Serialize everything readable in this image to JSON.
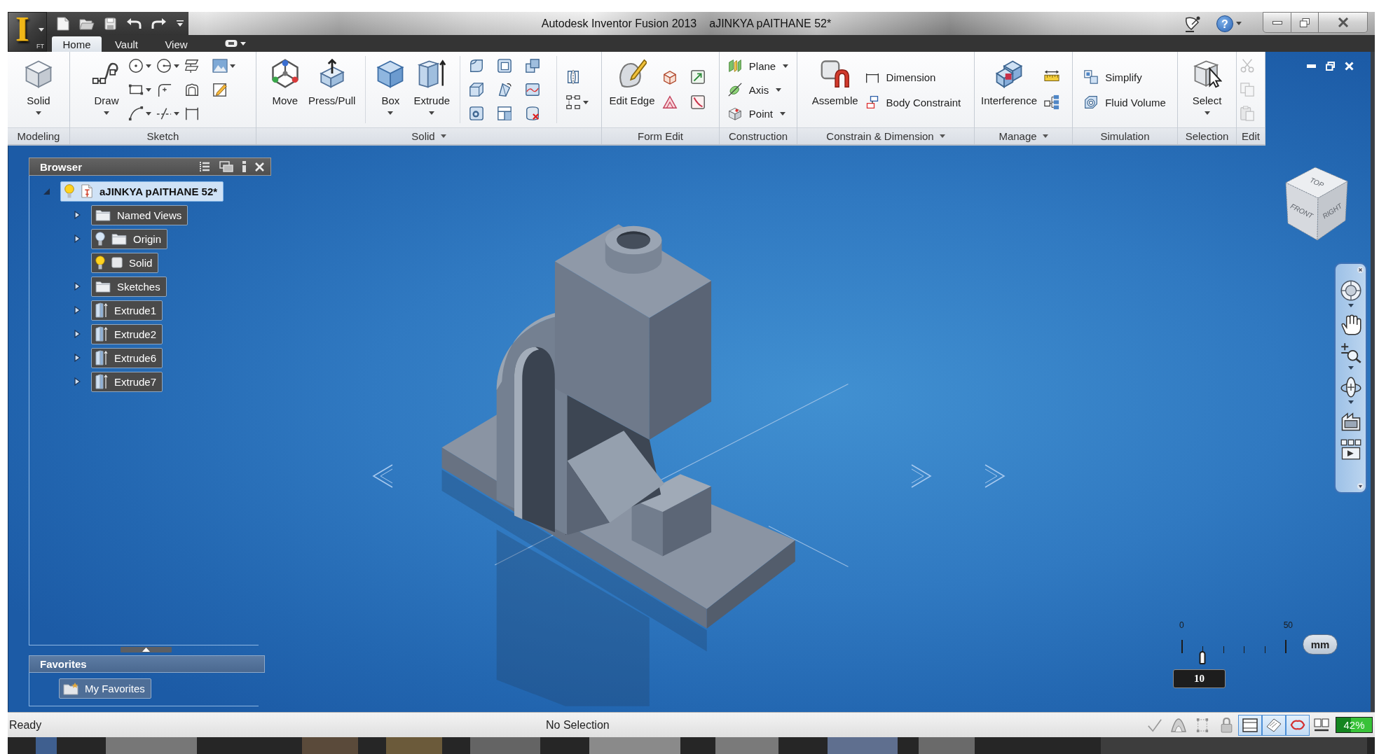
{
  "app_button": {
    "logo": "I",
    "badge": "FT"
  },
  "window": {
    "title": "Autodesk Inventor Fusion 2013",
    "document": "aJINKYA pAITHANE 52*"
  },
  "help_button": {
    "label": "?"
  },
  "tabs": [
    {
      "label": "Home",
      "selected": true
    },
    {
      "label": "Vault",
      "selected": false
    },
    {
      "label": "View",
      "selected": false
    }
  ],
  "ribbon": {
    "panels": [
      {
        "label": "Modeling",
        "expandable": false,
        "tools": [
          {
            "kind": "large",
            "label": "Solid",
            "dropdown": true
          }
        ]
      },
      {
        "label": "Sketch",
        "expandable": false,
        "tools": [
          {
            "kind": "large",
            "label": "Draw",
            "dropdown": true
          },
          {
            "kind": "icons",
            "rows": [
              [
                {
                  "dropdown": true
                },
                {
                  "dropdown": true
                },
                {
                  "dropdown": false
                },
                {
                  "dropdown": true
                }
              ],
              [
                {
                  "dropdown": true
                },
                {
                  "dropdown": false
                },
                {
                  "dropdown": false
                },
                {
                  "dropdown": false
                }
              ],
              [
                {
                  "dropdown": true
                },
                {
                  "dropdown": true
                },
                {
                  "dropdown": false
                }
              ]
            ]
          }
        ]
      },
      {
        "label": "Solid",
        "expandable": true,
        "tools": [
          {
            "kind": "large",
            "label": "Move",
            "dropdown": false
          },
          {
            "kind": "large",
            "label": "Press/Pull",
            "dropdown": false
          },
          {
            "kind": "large",
            "label": "Box",
            "dropdown": true
          },
          {
            "kind": "large",
            "label": "Extrude",
            "dropdown": true
          },
          {
            "kind": "icons",
            "rows": [
              [
                {
                  "dropdown": false
                },
                {
                  "dropdown": false
                },
                {
                  "dropdown": false
                }
              ],
              [
                {
                  "dropdown": false
                },
                {
                  "dropdown": false
                },
                {
                  "dropdown": false
                }
              ],
              [
                {
                  "dropdown": false
                },
                {
                  "dropdown": false
                },
                {
                  "dropdown": false
                }
              ]
            ]
          },
          {
            "kind": "icons",
            "rows": [
              [
                {
                  "dropdown": false
                }
              ],
              [
                {
                  "dropdown": true
                }
              ]
            ]
          }
        ]
      },
      {
        "label": "Form Edit",
        "expandable": false,
        "tools": [
          {
            "kind": "large",
            "label": "Edit Edge",
            "dropdown": false
          },
          {
            "kind": "icons",
            "rows": [
              [
                {
                  "dropdown": false
                },
                {
                  "dropdown": false
                }
              ],
              [
                {
                  "dropdown": false
                },
                {
                  "dropdown": false
                }
              ]
            ]
          }
        ]
      },
      {
        "label": "Construction",
        "expandable": false,
        "tools": [
          {
            "kind": "small",
            "label": "Plane",
            "dropdown": true
          },
          {
            "kind": "small",
            "label": "Axis",
            "dropdown": true
          },
          {
            "kind": "small",
            "label": "Point",
            "dropdown": true
          }
        ]
      },
      {
        "label": "Constrain & Dimension",
        "expandable": true,
        "tools": [
          {
            "kind": "large",
            "label": "Assemble",
            "dropdown": false
          },
          {
            "kind": "small",
            "label": "Dimension",
            "dropdown": false
          },
          {
            "kind": "small",
            "label": "Body Constraint",
            "dropdown": false
          }
        ]
      },
      {
        "label": "Manage",
        "expandable": true,
        "tools": [
          {
            "kind": "large",
            "label": "Interference",
            "dropdown": false
          },
          {
            "kind": "icons",
            "rows": [
              [
                {
                  "dropdown": false
                }
              ],
              [
                {
                  "dropdown": false
                }
              ]
            ]
          }
        ]
      },
      {
        "label": "Simulation",
        "expandable": false,
        "tools": [
          {
            "kind": "small",
            "label": "Simplify",
            "dropdown": false
          },
          {
            "kind": "small",
            "label": "Fluid Volume",
            "dropdown": false
          }
        ]
      },
      {
        "label": "Selection",
        "expandable": false,
        "tools": [
          {
            "kind": "large",
            "label": "Select",
            "dropdown": true
          }
        ]
      },
      {
        "label": "Edit",
        "expandable": false,
        "tools": [
          {
            "kind": "icons",
            "rows": [
              [
                {
                  "dropdown": false,
                  "disabled": true
                }
              ],
              [
                {
                  "dropdown": false,
                  "disabled": true
                }
              ],
              [
                {
                  "dropdown": false,
                  "disabled": true
                }
              ]
            ]
          }
        ]
      }
    ]
  },
  "browser": {
    "title": "Browser",
    "tree": [
      {
        "label": "aJINKYA pAITHANE 52*",
        "kind": "part",
        "lit": true,
        "expanded": true,
        "selected": true,
        "children": [
          {
            "label": "Named Views",
            "kind": "folder",
            "expanded": false,
            "selected": false
          },
          {
            "label": "Origin",
            "kind": "folder",
            "lit": false,
            "expanded": false,
            "selected": false
          },
          {
            "label": "Solid",
            "kind": "body",
            "lit": true,
            "selected": false
          },
          {
            "label": "Sketches",
            "kind": "folder",
            "expanded": false,
            "selected": false
          },
          {
            "label": "Extrude1",
            "kind": "extrude",
            "expanded": false,
            "selected": false
          },
          {
            "label": "Extrude2",
            "kind": "extrude",
            "expanded": false,
            "selected": false
          },
          {
            "label": "Extrude6",
            "kind": "extrude",
            "expanded": false,
            "selected": false
          },
          {
            "label": "Extrude7",
            "kind": "extrude",
            "expanded": false,
            "selected": false
          }
        ]
      }
    ]
  },
  "favorites": {
    "title": "Favorites",
    "items": [
      {
        "label": "My Favorites"
      }
    ]
  },
  "viewport": {
    "view_cube": {
      "top": "TOP",
      "front": "FRONT",
      "right": "RIGHT"
    },
    "navigation_bar": {
      "tools": [
        {
          "dropdown": true
        },
        {
          "dropdown": false
        },
        {
          "dropdown": true
        },
        {
          "dropdown": true
        },
        {
          "dropdown": false
        },
        {
          "dropdown": false
        }
      ]
    },
    "scale": {
      "min_label": "0",
      "max_label": "50",
      "unit": "mm",
      "value": "10",
      "level": 0.2
    }
  },
  "status_bar": {
    "message": "Ready",
    "selection": "No Selection",
    "toggles": [
      {
        "on": false
      },
      {
        "on": false
      },
      {
        "on": false
      },
      {
        "on": false
      },
      {
        "on": true
      },
      {
        "on": true
      },
      {
        "on": true
      },
      {
        "on": false
      }
    ],
    "meter": {
      "level": 0.42,
      "reading": "42%"
    }
  }
}
